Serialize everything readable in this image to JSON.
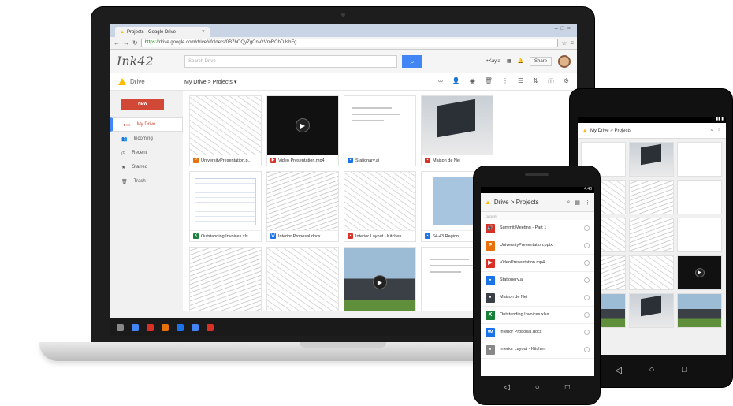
{
  "laptop": {
    "browser": {
      "tab_title": "Projects - Google Drive",
      "url_https": "https://",
      "url_rest": "drive.google.com/drive/#folders/0B7hOQyZgCnVzVmRCbDJsbFg",
      "window_controls": "–□×"
    },
    "header": {
      "logo": "Ink42",
      "search_placeholder": "Search Drive",
      "user": "+Kayla",
      "share_label": "Share"
    },
    "subheader": {
      "drive_label": "Drive",
      "breadcrumb": "My Drive > Projects ▾"
    },
    "sidebar": {
      "new_label": "NEW",
      "items": [
        {
          "icon": "▸▭",
          "label": "My Drive"
        },
        {
          "icon": "👥",
          "label": "Incoming"
        },
        {
          "icon": "◷",
          "label": "Recent"
        },
        {
          "icon": "★",
          "label": "Starred"
        },
        {
          "icon": "🗑",
          "label": "Trash"
        }
      ]
    },
    "files": [
      {
        "name": "UniversityPresentation.p...",
        "icon": "P",
        "color": "#e8710a",
        "thumb": "sketch"
      },
      {
        "name": "Video Presentation.mp4",
        "icon": "▶",
        "color": "#d93025",
        "thumb": "dark"
      },
      {
        "name": "Stationary.ai",
        "icon": "▪",
        "color": "#1a73e8",
        "thumb": "doc"
      },
      {
        "name": "Maison de Nei",
        "icon": "▪",
        "color": "#d93025",
        "thumb": "house"
      },
      {
        "name": "Outstanding Invoices.xls...",
        "icon": "X",
        "color": "#188038",
        "thumb": "sheet"
      },
      {
        "name": "Interior Proposal.docx",
        "icon": "W",
        "color": "#1a73e8",
        "thumb": "sketch2"
      },
      {
        "name": "Interior Layout - Kitchen",
        "icon": "▪",
        "color": "#d93025",
        "thumb": "sketch"
      },
      {
        "name": "64-43 Region...",
        "icon": "▪",
        "color": "#1a73e8",
        "thumb": "blue"
      },
      {
        "name": "",
        "icon": "",
        "color": "#ffffff",
        "thumb": "sketch2"
      },
      {
        "name": "",
        "icon": "",
        "color": "#ffffff",
        "thumb": "sketch"
      },
      {
        "name": "",
        "icon": "",
        "color": "#ffffff",
        "thumb": "photo"
      },
      {
        "name": "",
        "icon": "",
        "color": "#ffffff",
        "thumb": "doc"
      }
    ],
    "taskbar_colors": [
      "#4285f4",
      "#d93025",
      "#e8710a",
      "#1a73e8",
      "#4285f4",
      "#d93025"
    ]
  },
  "tablet": {
    "breadcrumb": "My Drive > Projects",
    "cells": [
      "",
      "",
      "",
      "",
      "",
      "",
      "",
      "",
      "",
      "",
      "",
      "",
      "",
      "",
      ""
    ]
  },
  "phone": {
    "status": "4:40",
    "title": "Drive > Projects",
    "section": "OLDER",
    "items": [
      {
        "name": "Summit Meeting - Part 1",
        "icon": "🔊",
        "color": "#d93025"
      },
      {
        "name": "UniversityPresentation.pptx",
        "icon": "P",
        "color": "#e8710a"
      },
      {
        "name": "VideoPresentation.mp4",
        "icon": "▶",
        "color": "#d93025"
      },
      {
        "name": "Stationery.ai",
        "icon": "▪",
        "color": "#1a73e8"
      },
      {
        "name": "Maison de Nei",
        "icon": "▪",
        "color": "#3b3f46"
      },
      {
        "name": "Outstanding Invoices.xlsx",
        "icon": "X",
        "color": "#188038"
      },
      {
        "name": "Interior Proposal.docx",
        "icon": "W",
        "color": "#1a73e8"
      },
      {
        "name": "Interior Layout - Kitchen",
        "icon": "▪",
        "color": "#888888"
      }
    ]
  }
}
